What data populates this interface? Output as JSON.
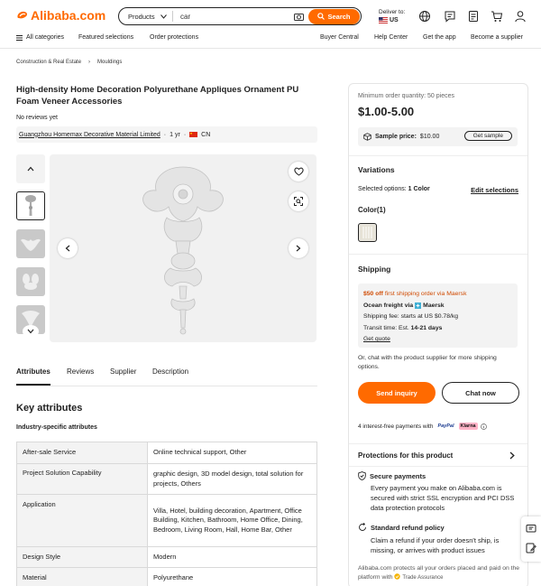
{
  "header": {
    "logo_text": "Alibaba.com",
    "search_category": "Products",
    "search_value": "car",
    "search_button": "Search",
    "deliver_label": "Deliver to:",
    "deliver_country": "US",
    "icons": [
      "globe-icon",
      "messages-icon",
      "orders-icon",
      "cart-icon",
      "account-icon"
    ]
  },
  "nav": {
    "all_categories": "All categories",
    "featured": "Featured selections",
    "order_protections": "Order protections",
    "buyer_central": "Buyer Central",
    "help_center": "Help Center",
    "get_app": "Get the app",
    "become_supplier": "Become a supplier"
  },
  "breadcrumb": [
    "Construction & Real Estate",
    "Mouldings"
  ],
  "product": {
    "title": "High-density Home Decoration Polyurethane Appliques Ornament PU Foam Veneer Accessories",
    "reviews": "No reviews yet",
    "supplier_name": "Guangzhou Homemax Decorative Material Limited",
    "supplier_years": "1 yr",
    "supplier_country": "CN"
  },
  "tabs": [
    "Attributes",
    "Reviews",
    "Supplier",
    "Description"
  ],
  "attributes": {
    "heading": "Key attributes",
    "subheading": "Industry-specific attributes",
    "rows": [
      {
        "key": "After-sale Service",
        "value": "Online technical support, Other"
      },
      {
        "key": "Project Solution Capability",
        "value": "graphic design, 3D model design, total solution for projects, Others"
      },
      {
        "key": "Application",
        "value": "Villa, Hotel, building decoration, Apartment, Office Building, Kitchen, Bathroom, Home Office, Dining, Bedroom, Living Room, Hall, Home Bar, Other"
      },
      {
        "key": "Design Style",
        "value": "Modern"
      },
      {
        "key": "Material",
        "value": "Polyurethane"
      }
    ]
  },
  "purchase": {
    "moq": "Minimum order quantity: 50 pieces",
    "price": "$1.00-5.00",
    "sample_label": "Sample price:",
    "sample_price": "$10.00",
    "get_sample": "Get sample",
    "variations_title": "Variations",
    "selected_options_label": "Selected options:",
    "selected_options_value": "1 Color",
    "edit_selections": "Edit selections",
    "color_label": "Color(1)",
    "shipping_title": "Shipping",
    "promo_amount": "$50 off",
    "promo_text": "first shipping order via Maersk",
    "freight_label": "Ocean freight via",
    "freight_carrier": "Maersk",
    "shipping_fee": "Shipping fee: starts at US $0.78/kg",
    "transit_label": "Transit time: Est.",
    "transit_days": "14-21 days",
    "get_quote": "Get quote",
    "or_chat": "Or, chat with the product supplier for more shipping options.",
    "send_inquiry": "Send inquiry",
    "chat_now": "Chat now",
    "installments": "4 interest-free payments with",
    "paypal": "PayPal",
    "klarna": "Klarna",
    "protections_title": "Protections for this product",
    "secure_title": "Secure payments",
    "secure_desc": "Every payment you make on Alibaba.com is secured with strict SSL encryption and PCI DSS data protection protocols",
    "refund_title": "Standard refund policy",
    "refund_desc": "Claim a refund if your order doesn't ship, is missing, or arrives with product issues",
    "protect_all": "Alibaba.com protects all your orders placed and paid on the platform with",
    "trade_assurance": "Trade Assurance"
  },
  "colors": {
    "accent": "#ff6a00",
    "promo": "#d04a02"
  }
}
